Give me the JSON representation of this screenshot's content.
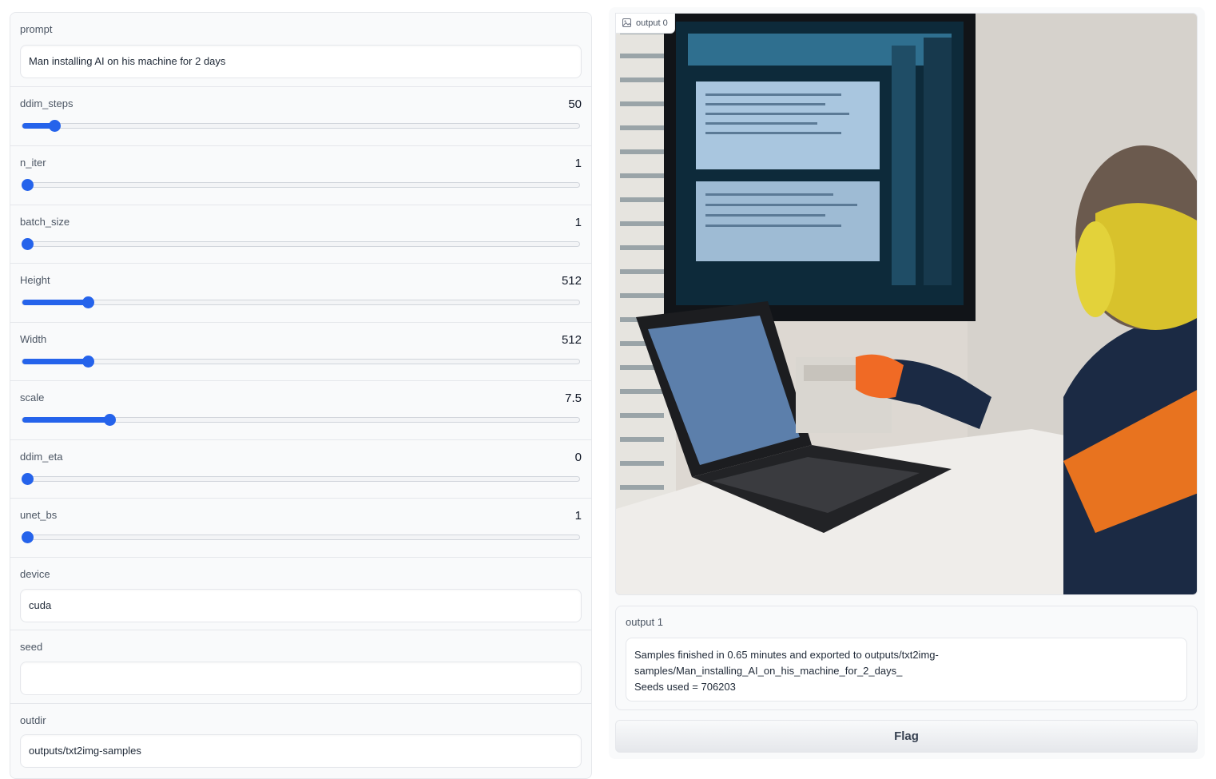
{
  "inputs": {
    "prompt": {
      "label": "prompt",
      "value": "Man installing AI on his machine for 2 days"
    },
    "ddim_steps": {
      "label": "ddim_steps",
      "value": "50",
      "fraction": 0.057
    },
    "n_iter": {
      "label": "n_iter",
      "value": "1",
      "fraction": 0.0
    },
    "batch_size": {
      "label": "batch_size",
      "value": "1",
      "fraction": 0.0
    },
    "height": {
      "label": "Height",
      "value": "512",
      "fraction": 0.118
    },
    "width": {
      "label": "Width",
      "value": "512",
      "fraction": 0.118
    },
    "scale": {
      "label": "scale",
      "value": "7.5",
      "fraction": 0.157
    },
    "ddim_eta": {
      "label": "ddim_eta",
      "value": "0",
      "fraction": 0.0
    },
    "unet_bs": {
      "label": "unet_bs",
      "value": "1",
      "fraction": 0.0
    },
    "device": {
      "label": "device",
      "value": "cuda"
    },
    "seed": {
      "label": "seed",
      "value": ""
    },
    "outdir": {
      "label": "outdir",
      "value": "outputs/txt2img-samples"
    }
  },
  "outputs": {
    "image_label": "output 0",
    "text_label": "output 1",
    "text_value": "Samples finished in 0.65 minutes and exported to outputs/txt2img-\nsamples/Man_installing_AI_on_his_machine_for_2_days_\nSeeds used = 706203"
  },
  "flag_label": "Flag",
  "colors": {
    "accent": "#2563eb",
    "panel_bg": "#f9fafb",
    "border": "#e5e7eb"
  }
}
